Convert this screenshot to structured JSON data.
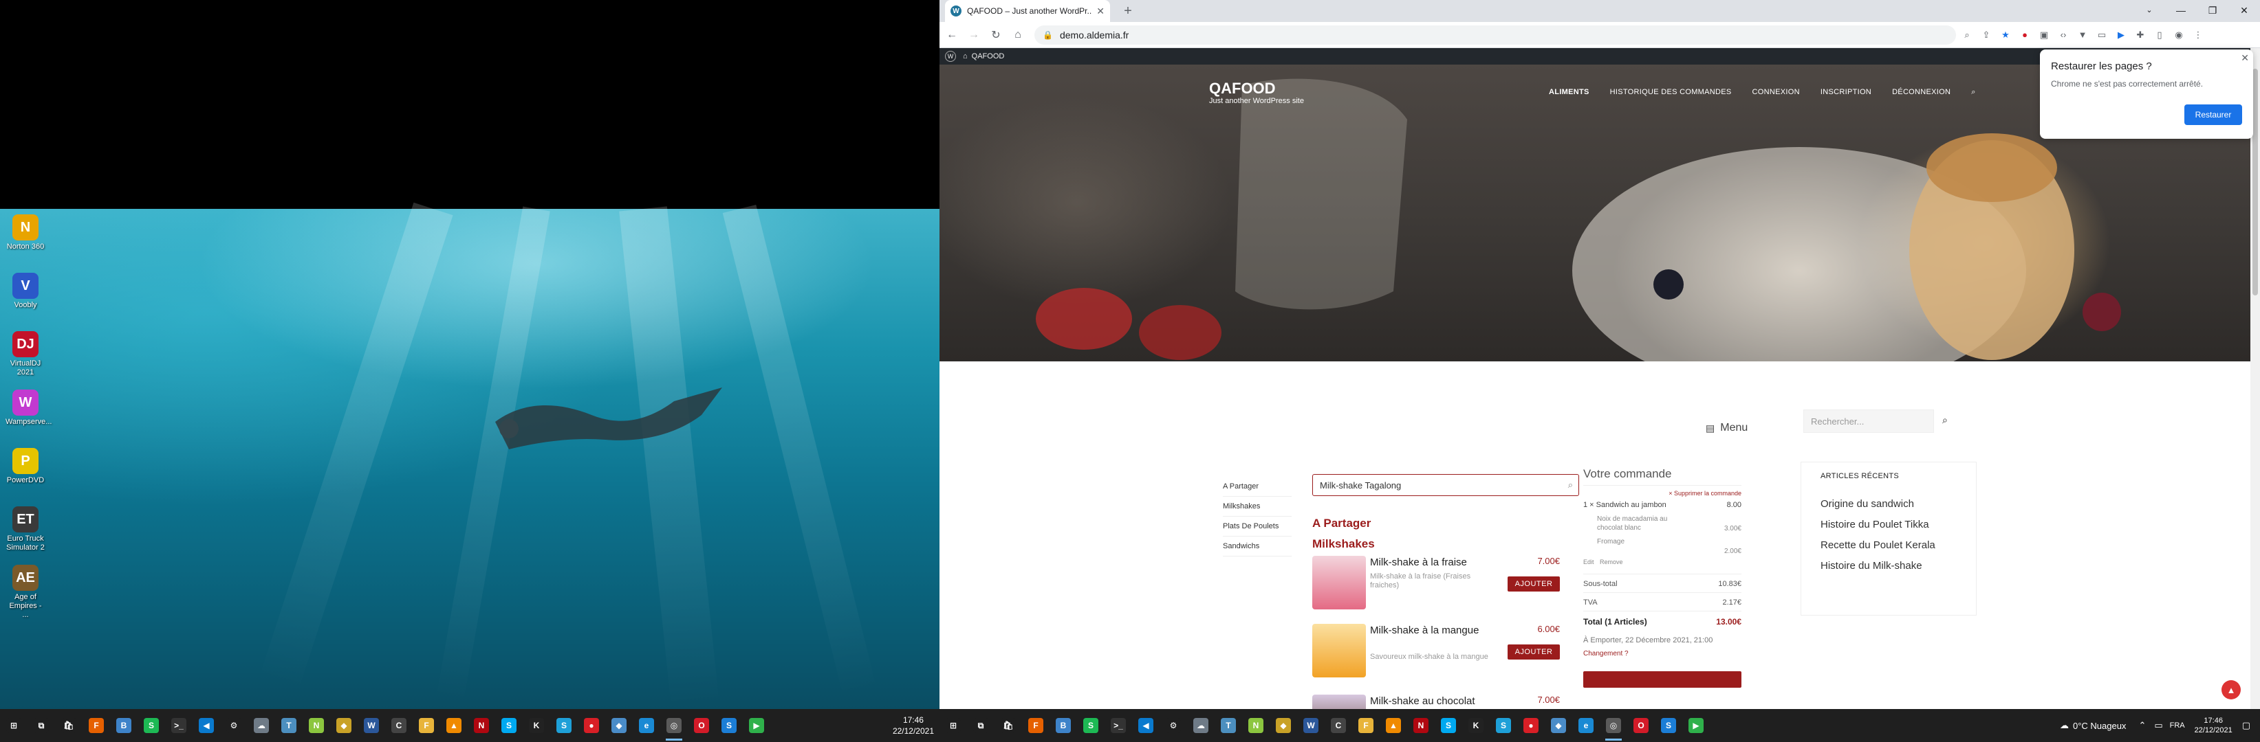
{
  "colors": {
    "brand_red": "#9b1c1c",
    "chrome_blue": "#1a73e8",
    "wp_admin_bar": "#23282d",
    "taskbar": "#1f1f1f"
  },
  "left_desktop": {
    "icons": [
      {
        "name": "norton-icon",
        "label": "Norton 360",
        "glyph": "N",
        "color": "#e8a400"
      },
      {
        "name": "voobly-icon",
        "label": "Voobly",
        "glyph": "V",
        "color": "#2b58c8"
      },
      {
        "name": "virtualdj-icon",
        "label": "VirtualDJ 2021",
        "glyph": "DJ",
        "color": "#c3122a"
      },
      {
        "name": "wampserver-icon",
        "label": "Wampserve...",
        "glyph": "W",
        "color": "#c23ad0"
      },
      {
        "name": "powerdvd-icon",
        "label": "PowerDVD",
        "glyph": "P",
        "color": "#e6c400"
      },
      {
        "name": "eurotruck-icon",
        "label": "Euro Truck Simulator 2",
        "glyph": "ET",
        "color": "#3a3a3a"
      },
      {
        "name": "aoe-icon",
        "label": "Age of Empires - ...",
        "glyph": "AE",
        "color": "#7a5a2a"
      }
    ],
    "taskbar": {
      "clock_time": "17:46",
      "clock_date": "22/12/2021",
      "apps": [
        {
          "name": "start-icon",
          "glyph": "⊞",
          "color": "#1f1f1f"
        },
        {
          "name": "taskview-icon",
          "glyph": "⧉",
          "color": "#1f1f1f"
        },
        {
          "name": "store-icon",
          "glyph": "🛍",
          "color": "#1f1f1f"
        },
        {
          "name": "firefox-icon",
          "glyph": "F",
          "color": "#e66000"
        },
        {
          "name": "app-blue-icon",
          "glyph": "B",
          "color": "#3e83c9"
        },
        {
          "name": "spotify-icon",
          "glyph": "S",
          "color": "#1db954"
        },
        {
          "name": "terminal-icon",
          "glyph": ">_",
          "color": "#333333"
        },
        {
          "name": "vscode-icon",
          "glyph": "◀",
          "color": "#0a7ace"
        },
        {
          "name": "settings-icon",
          "glyph": "⚙",
          "color": "#1f1f1f"
        },
        {
          "name": "cloud-icon",
          "glyph": "☁",
          "color": "#6f7b87"
        },
        {
          "name": "tool-icon",
          "glyph": "T",
          "color": "#4c8fbf"
        },
        {
          "name": "notepad-icon",
          "glyph": "N",
          "color": "#8cc63f"
        },
        {
          "name": "diamond-icon",
          "glyph": "◆",
          "color": "#c9a227"
        },
        {
          "name": "word-icon",
          "glyph": "W",
          "color": "#2b579a"
        },
        {
          "name": "cmd-icon",
          "glyph": "C",
          "color": "#444444"
        },
        {
          "name": "folder-icon",
          "glyph": "F",
          "color": "#e8b43a"
        },
        {
          "name": "vlc-icon",
          "glyph": "▲",
          "color": "#f08a00"
        },
        {
          "name": "netflix-icon",
          "glyph": "N",
          "color": "#b00710"
        },
        {
          "name": "skype-icon",
          "glyph": "S",
          "color": "#00a9f0"
        },
        {
          "name": "app-k-icon",
          "glyph": "K",
          "color": "#222222"
        },
        {
          "name": "app-sq-icon",
          "glyph": "S",
          "color": "#1ea0d8"
        },
        {
          "name": "record-icon",
          "glyph": "●",
          "color": "#d81f26"
        },
        {
          "name": "app-diamond2-icon",
          "glyph": "◆",
          "color": "#4a8cc8"
        },
        {
          "name": "edge-icon",
          "glyph": "e",
          "color": "#1a8ad4"
        },
        {
          "name": "chrome-icon",
          "glyph": "◎",
          "color": "#5a5a5a"
        },
        {
          "name": "opera-icon",
          "glyph": "O",
          "color": "#d31b28"
        },
        {
          "name": "skype2-icon",
          "glyph": "S",
          "color": "#1c7ed6"
        },
        {
          "name": "app-green-icon",
          "glyph": "▶",
          "color": "#2fb14b"
        }
      ]
    }
  },
  "browser": {
    "tab_title": "QAFOOD – Just another WordPr...",
    "url": "demo.aldemia.fr",
    "wp_bar_site": "QAFOOD",
    "restore_popup": {
      "title": "Restaurer les pages ?",
      "message": "Chrome ne s'est pas correctement arrêté.",
      "button": "Restaurer"
    }
  },
  "site": {
    "title": "QAFOOD",
    "description": "Just another WordPress site",
    "nav": [
      "ALIMENTS",
      "HISTORIQUE DES COMMANDES",
      "CONNEXION",
      "INSCRIPTION",
      "DÉCONNEXION"
    ],
    "menu_link": "Menu",
    "search_placeholder": "Rechercher...",
    "categories": [
      "A Partager",
      "Milkshakes",
      "Plats De Poulets",
      "Sandwichs"
    ],
    "product_search_value": "Milk-shake Tagalong",
    "section_partager": "A Partager",
    "section_milkshakes": "Milkshakes",
    "products": [
      {
        "name": "Milk-shake à la fraise",
        "desc": "Milk-shake à la fraise (Fraises fraiches)",
        "price": "7.00€",
        "add": "AJOUTER"
      },
      {
        "name": "Milk-shake à la mangue",
        "desc": "Savoureux milk-shake à la mangue",
        "price": "6.00€",
        "add": "AJOUTER"
      },
      {
        "name": "Milk-shake au chocolat",
        "price": "7.00€"
      }
    ],
    "order": {
      "title": "Votre commande",
      "delete_all": "× Supprimer la commande",
      "item_qty": "1 ×",
      "item_name": "Sandwich au jambon",
      "item_price": "8.00",
      "option1": "Noix de macadamia au chocolat blanc",
      "option1_price": "3.00€",
      "option2": "Fromage",
      "option2_price": "2.00€",
      "edit": "Edit",
      "remove": "Remove",
      "subtotal_label": "Sous-total",
      "subtotal_value": "10.83€",
      "tva_label": "TVA",
      "tva_value": "2.17€",
      "total_label": "Total (1 Articles)",
      "total_value": "13.00€",
      "pickup": "À Emporter, 22 Décembre 2021, 21:00",
      "change": "Changement ?"
    },
    "recent": {
      "heading": "ARTICLES RÉCENTS",
      "links": [
        "Origine du sandwich",
        "Histoire du Poulet Tikka",
        "Recette du Poulet Kerala",
        "Histoire du Milk-shake"
      ]
    }
  },
  "right_taskbar": {
    "weather": "0°C  Nuageux",
    "lang": "FRA",
    "clock_time": "17:46",
    "clock_date": "22/12/2021"
  }
}
